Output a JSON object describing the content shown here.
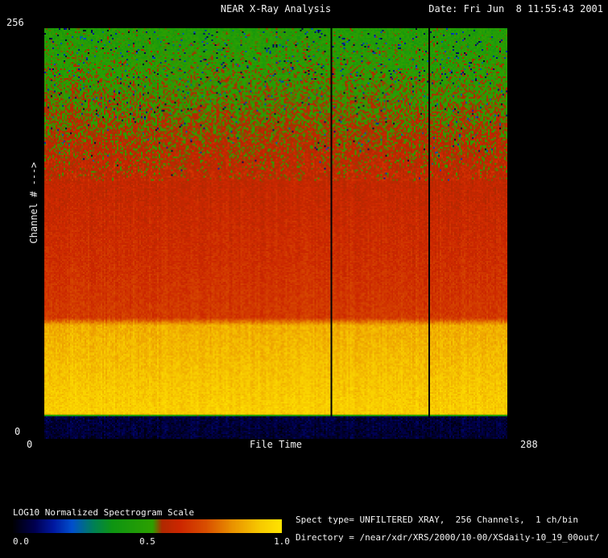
{
  "header": {
    "title": "NEAR X-Ray Analysis",
    "date": "Date: Fri Jun  8 11:55:43 2001"
  },
  "axes": {
    "y_top": "256",
    "y_bottom": "0",
    "y_label": "Channel # --->",
    "x_left": "0",
    "x_right": "288",
    "x_label": "File Time"
  },
  "colorbar": {
    "title": "LOG10 Normalized Spectrogram Scale",
    "tick_left": "0.0",
    "tick_mid": "0.5",
    "tick_right": "1.0"
  },
  "info": {
    "spect_type": "Spect type= UNFILTERED XRAY,  256 Channels,  1 ch/bin",
    "directory": "Directory = /near/xdr/XRS/2000/10-00/XSdaily-10_19_00out/"
  },
  "chart_data": {
    "type": "heatmap",
    "title": "NEAR X-Ray Analysis",
    "xlabel": "File Time",
    "ylabel": "Channel #",
    "xlim": [
      0,
      288
    ],
    "ylim": [
      0,
      256
    ],
    "bins": {
      "x": 288,
      "y": 256
    },
    "scale": {
      "label": "LOG10 Normalized Spectrogram Scale",
      "range": [
        0.0,
        1.0
      ]
    },
    "colormap_stops": [
      [
        0.0,
        "#000005"
      ],
      [
        0.08,
        "#000050"
      ],
      [
        0.15,
        "#0018a0"
      ],
      [
        0.22,
        "#0050cc"
      ],
      [
        0.3,
        "#008055"
      ],
      [
        0.37,
        "#0e9512"
      ],
      [
        0.52,
        "#2da000"
      ],
      [
        0.555,
        "#b02800"
      ],
      [
        0.62,
        "#cc2600"
      ],
      [
        0.72,
        "#d94f00"
      ],
      [
        0.82,
        "#ea9400"
      ],
      [
        0.92,
        "#f7c900"
      ],
      [
        1.0,
        "#ffe400"
      ]
    ],
    "bands": [
      {
        "ch": [
          0,
          13
        ],
        "v": [
          0.05,
          0.06
        ]
      },
      {
        "ch": [
          13,
          15
        ],
        "v": [
          0.06,
          0.92
        ]
      },
      {
        "ch": [
          15,
          70
        ],
        "v": [
          0.94,
          0.87
        ]
      },
      {
        "ch": [
          70,
          75
        ],
        "v": [
          0.87,
          0.67
        ]
      },
      {
        "ch": [
          75,
          160
        ],
        "v": [
          0.67,
          0.6
        ]
      },
      {
        "ch": [
          160,
          215
        ],
        "v": [
          0.6,
          0.52
        ]
      },
      {
        "ch": [
          215,
          256
        ],
        "v": [
          0.52,
          0.47
        ]
      }
    ],
    "noise": {
      "pixel": 0.035,
      "column": 0.018,
      "upper_extra": 0.05,
      "speckle_start": 160,
      "speckle_base": 0.002,
      "speckle_max": 0.05
    },
    "gap_lines_x": [
      178,
      239
    ]
  }
}
